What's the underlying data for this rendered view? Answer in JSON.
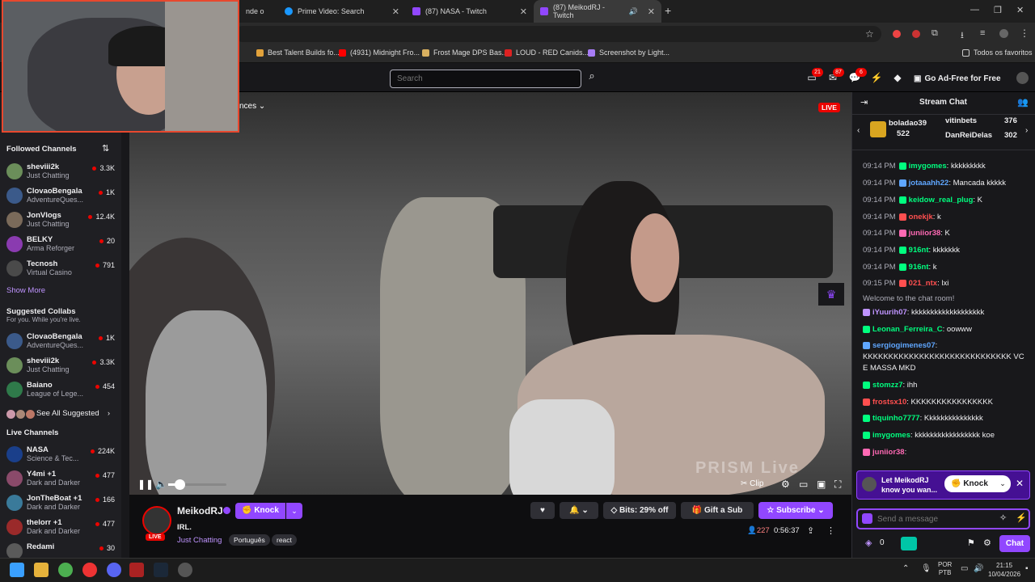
{
  "browser": {
    "tabs": [
      {
        "title": "nde o",
        "active": false
      },
      {
        "title": "Prime Video: Search",
        "active": false
      },
      {
        "title": "(87) NASA - Twitch",
        "active": false
      },
      {
        "title": "(87) MeikodRJ - Twitch",
        "active": true
      }
    ],
    "new_tab": "+",
    "bookmarks": [
      "Best Talent Builds fo...",
      "(4931) Midnight Fro...",
      "Frost Mage DPS Bas...",
      "LOUD - RED Canids...",
      "Screenshot by Light..."
    ],
    "all_bookmarks": "Todos os favoritos"
  },
  "twitch_top": {
    "search_placeholder": "Search",
    "badge_inbox": "21",
    "badge_notif": "87",
    "badge_whispers": "6",
    "adfree": "Go Ad-Free for Free"
  },
  "sidebar": {
    "followed_title": "Followed Channels",
    "followed": [
      {
        "name": "sheviii2k",
        "cat": "Just Chatting",
        "viewers": "3.3K",
        "color": "#6b8e5a"
      },
      {
        "name": "ClovaoBengala",
        "cat": "AdventureQues...",
        "viewers": "1K",
        "color": "#3b5a8a"
      },
      {
        "name": "JonVlogs",
        "cat": "Just Chatting",
        "viewers": "12.4K",
        "color": "#7a6a5a"
      },
      {
        "name": "BELKY",
        "cat": "Arma Reforger",
        "viewers": "20",
        "color": "#8a3bb0"
      },
      {
        "name": "Tecnosh",
        "cat": "Virtual Casino",
        "viewers": "791",
        "color": "#4a4a4a"
      }
    ],
    "show_more": "Show More",
    "collabs_title": "Suggested Collabs",
    "collabs_sub": "For you. While you're live.",
    "collabs": [
      {
        "name": "ClovaoBengala",
        "cat": "AdventureQues...",
        "viewers": "1K",
        "color": "#3b5a8a"
      },
      {
        "name": "sheviii2k",
        "cat": "Just Chatting",
        "viewers": "3.3K",
        "color": "#6b8e5a"
      },
      {
        "name": "Baiano",
        "cat": "League of Lege...",
        "viewers": "454",
        "color": "#2f7a4a"
      }
    ],
    "see_all": "See All Suggested",
    "live_title": "Live Channels",
    "live": [
      {
        "name": "NASA",
        "cat": "Science & Tec...",
        "viewers": "224K",
        "color": "#1a3f8a"
      },
      {
        "name": "Y4mi +1",
        "cat": "Dark and Darker",
        "viewers": "477",
        "color": "#8a4a6a"
      },
      {
        "name": "JonTheBoat +1",
        "cat": "Dark and Darker",
        "viewers": "166",
        "color": "#3a7a9a"
      },
      {
        "name": "thelorr +1",
        "cat": "Dark and Darker",
        "viewers": "477",
        "color": "#9a2a2a"
      },
      {
        "name": "Redami",
        "cat": "",
        "viewers": "30",
        "color": "#5a5a5a"
      }
    ]
  },
  "video": {
    "live": "LIVE",
    "quality_fragment": "nces",
    "watermark": "PRISM Live",
    "clip": "Clip",
    "volume_level": 0.2
  },
  "stream": {
    "streamer": "MeikodRJ",
    "live": "LIVE",
    "knock": "Knock",
    "title": "IRL.",
    "category": "Just Chatting",
    "tags": [
      "Português",
      "react"
    ],
    "bits": "Bits: 29% off",
    "gift": "Gift a Sub",
    "subscribe": "Subscribe",
    "viewers": "227",
    "uptime": "0:56:37"
  },
  "chat": {
    "title": "Stream Chat",
    "leaders": [
      {
        "name": "boladao39",
        "value": "522"
      },
      {
        "name": "vitinbets",
        "value": "376"
      },
      {
        "name": "DanReiDelas",
        "value": "302"
      }
    ],
    "messages": [
      {
        "time": "09:14 PM",
        "user": "imygomes",
        "color": "#00ff7f",
        "text": ": kkkkkkkkk"
      },
      {
        "time": "09:14 PM",
        "user": "jotaaahh22",
        "color": "#5fa6ff",
        "text": ": Mancada kkkkk"
      },
      {
        "time": "09:14 PM",
        "user": "keidow_real_plug",
        "color": "#00ff7f",
        "text": ": K"
      },
      {
        "time": "09:14 PM",
        "user": "onekjk",
        "color": "#ff4f4f",
        "text": ": k"
      },
      {
        "time": "09:14 PM",
        "user": "juniior38",
        "color": "#ff69b4",
        "text": ": K"
      },
      {
        "time": "09:14 PM",
        "user": "916nt",
        "color": "#00ff7f",
        "text": ": kkkkkkk"
      },
      {
        "time": "09:14 PM",
        "user": "916nt",
        "color": "#00ff7f",
        "text": ": k"
      },
      {
        "time": "09:15 PM",
        "user": "021_ntx",
        "color": "#ff4f4f",
        "text": ": lxi"
      },
      {
        "time": "",
        "user": "",
        "color": "#adadb8",
        "text": "Welcome to the chat room!"
      },
      {
        "time": "",
        "user": "iYuurih07",
        "color": "#bf94ff",
        "text": ": kkkkkkkkkkkkkkkkkkk"
      },
      {
        "time": "",
        "user": "Leonan_Ferreira_C",
        "color": "#00ff7f",
        "text": ": oowww"
      },
      {
        "time": "",
        "user": "sergiogimenes07",
        "color": "#5fa6ff",
        "text": ": KKKKKKKKKKKKKKKKKKKKKKKKKKKKK VC E MASSA MKD"
      },
      {
        "time": "",
        "user": "stomzz7",
        "color": "#00ff7f",
        "text": ": ihh"
      },
      {
        "time": "",
        "user": "frostsx10",
        "color": "#ff4f4f",
        "text": ": KKKKKKKKKKKKKKKK"
      },
      {
        "time": "",
        "user": "tiquinho7777",
        "color": "#00ff7f",
        "text": ": Kkkkkkkkkkkkkkk"
      },
      {
        "time": "",
        "user": "imygomes",
        "color": "#00ff7f",
        "text": ": kkkkkkkkkkkkkkkkk koe"
      },
      {
        "time": "",
        "user": "juniior38",
        "color": "#ff69b4",
        "text": ":"
      }
    ],
    "knock_prompt": "Let MeikodRJ know you wan...",
    "knock": "Knock",
    "input_placeholder": "Send a message",
    "points": "0",
    "chat_button": "Chat"
  },
  "taskbar": {
    "lang1": "POR",
    "lang2": "PTB",
    "time": "21:15",
    "date": "10/04/2026"
  }
}
